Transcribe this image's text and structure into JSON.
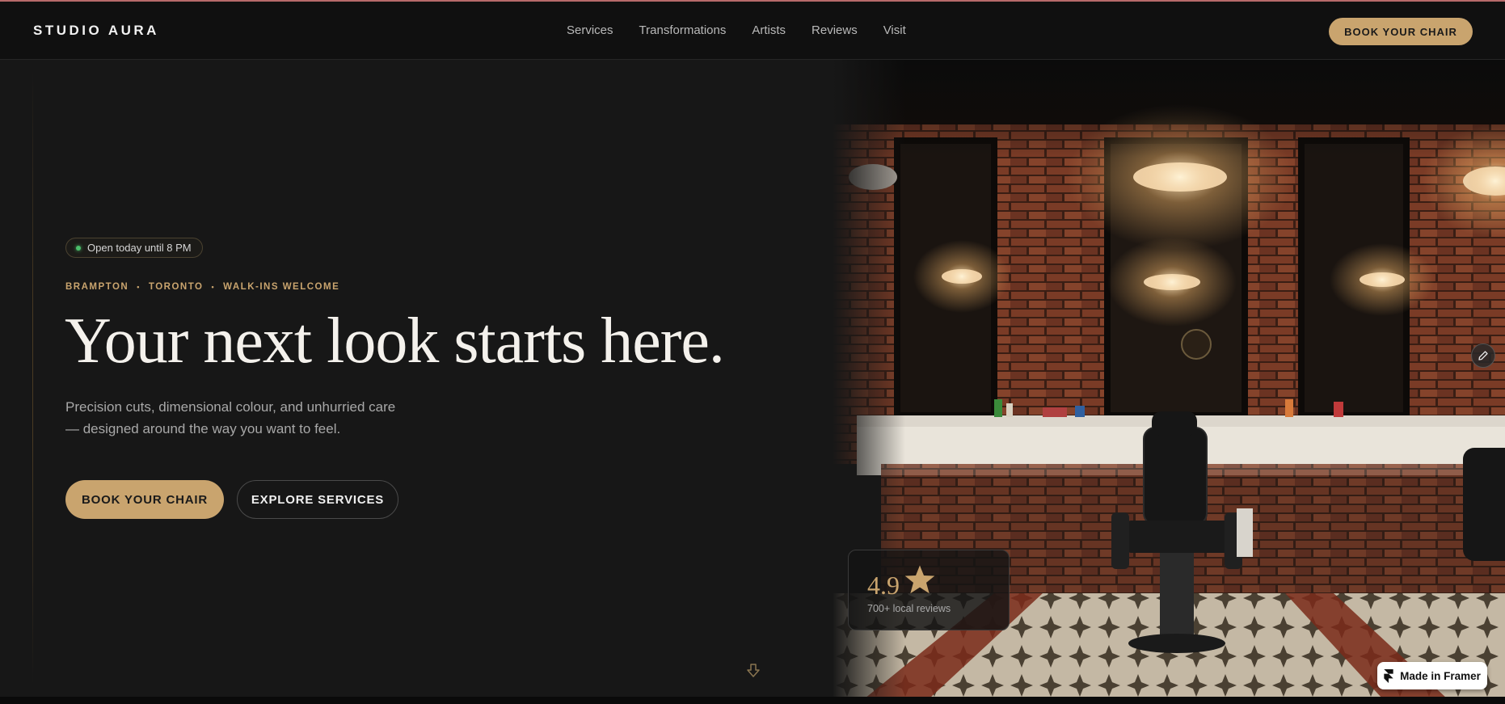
{
  "brand": "STUDIO AURA",
  "nav": {
    "links": [
      "Services",
      "Transformations",
      "Artists",
      "Reviews",
      "Visit"
    ],
    "cta": "BOOK YOUR CHAIR"
  },
  "hero": {
    "status": "Open today until 8 PM",
    "locations": [
      "BRAMPTON",
      "TORONTO",
      "WALK-INS WELCOME"
    ],
    "separator": "•",
    "headline": "Your next look starts here.",
    "subtext": "Precision cuts, dimensional colour, and unhurried care — designed around the way you want to feel.",
    "primary_cta": "BOOK YOUR CHAIR",
    "secondary_cta": "EXPLORE SERVICES"
  },
  "rating": {
    "value": "4.9",
    "label": "700+ local reviews"
  },
  "badge": {
    "label": "Made in Framer"
  },
  "colors": {
    "accent": "#c9a46e",
    "background": "#171717",
    "nav_background": "#101010",
    "status_dot": "#4bbf6b"
  },
  "icons": {
    "status": "status-dot-icon",
    "rating": "star-icon",
    "scroll": "arrow-down-icon",
    "edit": "pencil-icon",
    "framer": "framer-logo-icon"
  }
}
